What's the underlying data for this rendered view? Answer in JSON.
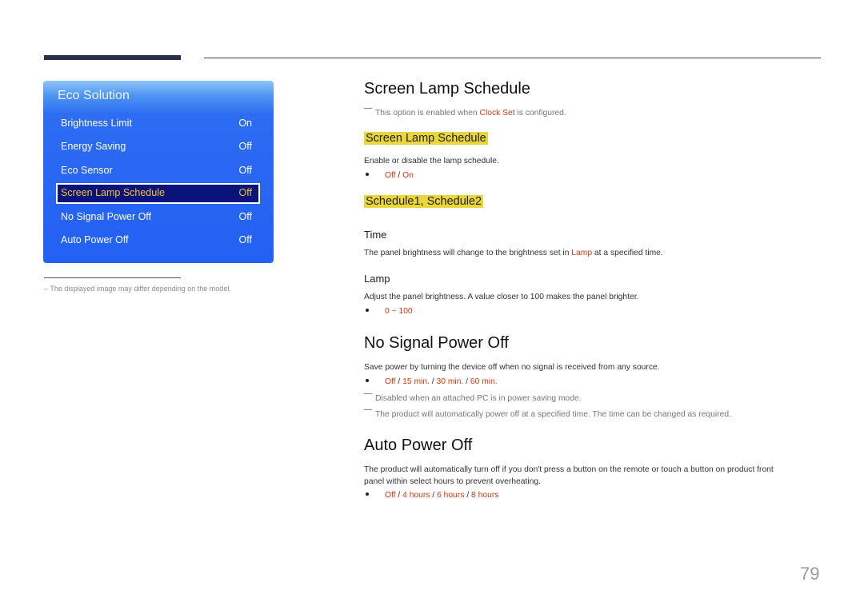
{
  "eco_panel": {
    "title": "Eco Solution",
    "items": [
      {
        "label": "Brightness Limit",
        "value": "On"
      },
      {
        "label": "Energy Saving",
        "value": "Off"
      },
      {
        "label": "Eco Sensor",
        "value": "Off"
      },
      {
        "label": "Screen Lamp Schedule",
        "value": "Off",
        "selected": true
      },
      {
        "label": "No Signal Power Off",
        "value": "Off"
      },
      {
        "label": "Auto Power Off",
        "value": "Off"
      }
    ],
    "colors": {
      "panel": "#2360f4",
      "selected_bg": "#0a137a",
      "selected_text": "#f0c23a"
    }
  },
  "left_note": "– The displayed image may differ depending on the model.",
  "sections": {
    "screen_lamp": {
      "title": "Screen Lamp Schedule",
      "note_prefix": "This option is enabled when ",
      "note_link": "Clock Set",
      "note_suffix": " is configured.",
      "sub1": {
        "title": "Screen Lamp Schedule",
        "desc": "Enable or disable the lamp schedule.",
        "options": [
          "Off",
          "On"
        ]
      },
      "sub2": {
        "title": "Schedule1, Schedule2",
        "time_title": "Time",
        "time_desc_prefix": "The panel brightness will change to the brightness set in ",
        "time_desc_link": "Lamp",
        "time_desc_suffix": " at a specified time.",
        "lamp_title": "Lamp",
        "lamp_desc": "Adjust the panel brightness. A value closer to 100 makes the panel brighter.",
        "lamp_range": "0 ~ 100"
      }
    },
    "no_signal": {
      "title": "No Signal Power Off",
      "desc": "Save power by turning the device off when no signal is received from any source.",
      "options": [
        "Off",
        "15 min.",
        "30 min.",
        "60 min."
      ],
      "notes": [
        "Disabled when an attached PC is in power saving mode.",
        "The product will automatically power off at a specified time. The time can be changed as required."
      ]
    },
    "auto_power_off": {
      "title": "Auto Power Off",
      "desc_line1": "The product will automatically turn off if you don't press a button on the remote or touch a button on product front",
      "desc_line2": "panel within select hours to prevent overheating.",
      "options": [
        "Off",
        "4 hours",
        "6 hours",
        "8 hours"
      ]
    }
  },
  "option_separator": " / ",
  "accent_color": "#d03a14",
  "highlight_color": "#e9d63c",
  "page_number": "79"
}
